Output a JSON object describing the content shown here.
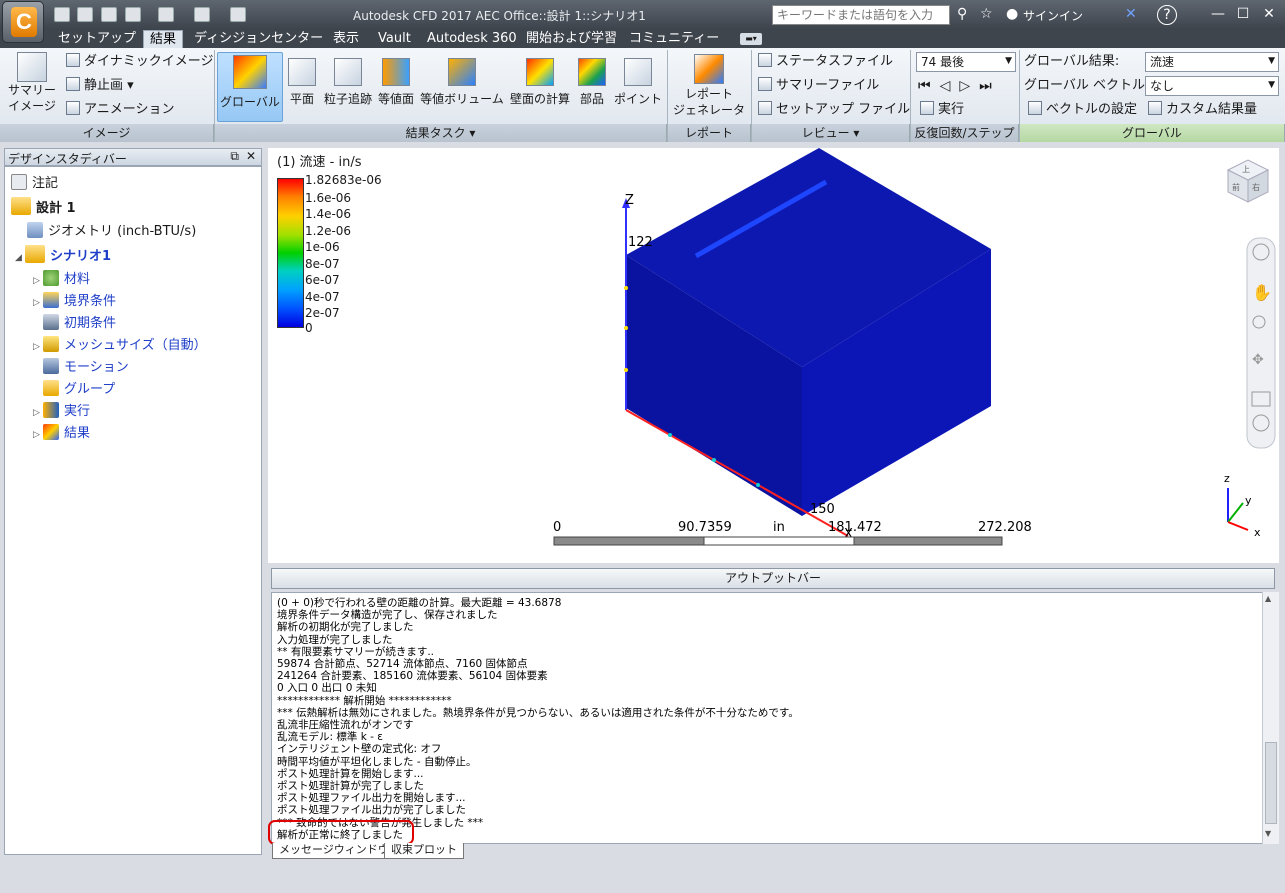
{
  "titlebar": {
    "title": "Autodesk CFD 2017   AEC Office::設計 1::シナリオ1",
    "search_placeholder": "キーワードまたは語句を入力",
    "signin": "サインイン",
    "help": "?"
  },
  "tabs": [
    "セットアップ",
    "結果",
    "ディシジョンセンター",
    "表示",
    "Vault",
    "Autodesk 360",
    "開始および学習",
    "コミュニティー"
  ],
  "ribbon": {
    "image_panel": {
      "summary_image": "サマリー\nイメージ",
      "dynamic_image": "ダイナミックイメージ",
      "still_image": "静止画",
      "animation": "アニメーション",
      "label": "イメージ"
    },
    "task_panel": {
      "buttons": [
        "グローバル",
        "平面",
        "粒子追跡",
        "等値面",
        "等値ボリューム",
        "壁面の計算",
        "部品",
        "ポイント"
      ],
      "label": "結果タスク"
    },
    "report_panel": {
      "button": "レポート\nジェネレータ",
      "label": "レポート"
    },
    "review_panel": {
      "status_file": "ステータスファイル",
      "summary_file": "サマリーファイル",
      "setup_file": "セットアップ ファイル",
      "label": "レビュー"
    },
    "iter_panel": {
      "step": "74 最後",
      "run": "実行",
      "label": "反復回数/ステップ"
    },
    "global_panel": {
      "result_label": "グローバル結果:",
      "result_value": "流速",
      "vector_label": "グローバル ベクトル:",
      "vector_value": "なし",
      "vector_settings": "ベクトルの設定",
      "custom_result": "カスタム結果量",
      "label": "グローバル"
    }
  },
  "design_study": {
    "header": "デザインスタディバー",
    "items": [
      {
        "label": "注記"
      },
      {
        "label": "設計 1"
      },
      {
        "label": "ジオメトリ (inch-BTU/s)"
      },
      {
        "label": "シナリオ1"
      },
      {
        "label": "材料"
      },
      {
        "label": "境界条件"
      },
      {
        "label": "初期条件"
      },
      {
        "label": "メッシュサイズ（自動）"
      },
      {
        "label": "モーション"
      },
      {
        "label": "グループ"
      },
      {
        "label": "実行"
      },
      {
        "label": "結果"
      }
    ]
  },
  "legend": {
    "title": "(1) 流速 - in/s",
    "ticks": [
      "1.82683e-06",
      "1.6e-06",
      "1.4e-06",
      "1.2e-06",
      "1e-06",
      "8e-07",
      "6e-07",
      "4e-07",
      "2e-07",
      "0"
    ]
  },
  "scene": {
    "axis_z_label": "Z",
    "axis_z_value": "122",
    "axis_x_label": "X",
    "axis_x_value": "150",
    "scale_ticks": [
      "0",
      "90.7359",
      "181.472",
      "272.208"
    ],
    "scale_unit": "in",
    "triad": {
      "z": "z",
      "y": "y",
      "x": "x"
    },
    "viewcube_faces": [
      "上",
      "前",
      "右"
    ]
  },
  "output": {
    "bar": "アウトプットバー",
    "lines": [
      "(0 + 0)秒で行われる壁の距離の計算。最大距離 = 43.6878",
      "境界条件データ構造が完了し、保存されました",
      "解析の初期化が完了しました",
      "入力処理が完了しました",
      "** 有限要素サマリーが続きます..",
      "59874 合計節点、52714 流体節点、7160 固体節点",
      "241264 合計要素、185160 流体要素、56104 固体要素",
      "0 入口  0 出口 0 未知",
      "************ 解析開始 ************",
      "*** 伝熱解析は無効にされました。熱境界条件が見つからない、あるいは適用された条件が不十分なためです。",
      "乱流非圧縮性流れがオンです",
      "乱流モデル: 標準 k - ε",
      "インテリジェント壁の定式化: オフ",
      "時間平均値が平坦化しました - 自動停止。",
      "ポスト処理計算を開始します...",
      "ポスト処理計算が完了しました",
      "ポスト処理ファイル出力を開始します...",
      "ポスト処理ファイル出力が完了しました",
      "*** 致命的ではない警告が発生しました ***",
      "解析が正常に終了しました"
    ],
    "tabs": [
      "メッセージウィンドウ",
      "収束プロット"
    ]
  },
  "colors": {
    "accent_select": "#96c8f4",
    "highlight": "#e00000",
    "link_blue": "#1f3fc8",
    "model_blue": "#0a14a8"
  }
}
